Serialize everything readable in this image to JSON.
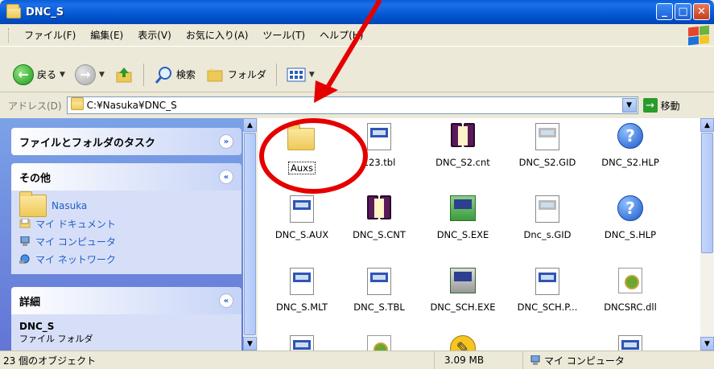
{
  "window": {
    "title": "DNC_S"
  },
  "menu": [
    "ファイル(F)",
    "編集(E)",
    "表示(V)",
    "お気に入り(A)",
    "ツール(T)",
    "ヘルプ(H)"
  ],
  "toolbar": {
    "back": "戻る",
    "search": "検索",
    "folders": "フォルダ"
  },
  "address": {
    "label": "アドレス(D)",
    "path": "C:¥Nasuka¥DNC_S",
    "go": "移動"
  },
  "tasks": {
    "file_folder_tasks": "ファイルとフォルダのタスク",
    "other": {
      "title": "その他",
      "items": [
        "Nasuka",
        "マイ ドキュメント",
        "マイ コンピュータ",
        "マイ ネットワーク"
      ]
    },
    "details": {
      "title": "詳細",
      "name": "DNC_S",
      "type": "ファイル フォルダ"
    }
  },
  "files": [
    {
      "name": "Auxs",
      "icon": "folder-icon"
    },
    {
      "name": "123.tbl",
      "icon": "document-icon"
    },
    {
      "name": "DNC_S2.cnt",
      "icon": "help-book-icon"
    },
    {
      "name": "DNC_S2.GID",
      "icon": "document-icon"
    },
    {
      "name": "DNC_S2.HLP",
      "icon": "help-icon"
    },
    {
      "name": "DNC_S.AUX",
      "icon": "document-icon"
    },
    {
      "name": "DNC_S.CNT",
      "icon": "help-book-icon"
    },
    {
      "name": "DNC_S.EXE",
      "icon": "executable-icon"
    },
    {
      "name": "Dnc_s.GID",
      "icon": "document-icon"
    },
    {
      "name": "DNC_S.HLP",
      "icon": "help-icon"
    },
    {
      "name": "DNC_S.MLT",
      "icon": "document-icon"
    },
    {
      "name": "DNC_S.TBL",
      "icon": "document-icon"
    },
    {
      "name": "DNC_SCH.EXE",
      "icon": "executable-icon"
    },
    {
      "name": "DNC_SCH.P...",
      "icon": "document-icon"
    },
    {
      "name": "DNCSRC.dll",
      "icon": "dll-icon"
    }
  ],
  "status": {
    "count": "23 個のオブジェクト",
    "size": "3.09 MB",
    "location": "マイ コンピュータ"
  }
}
